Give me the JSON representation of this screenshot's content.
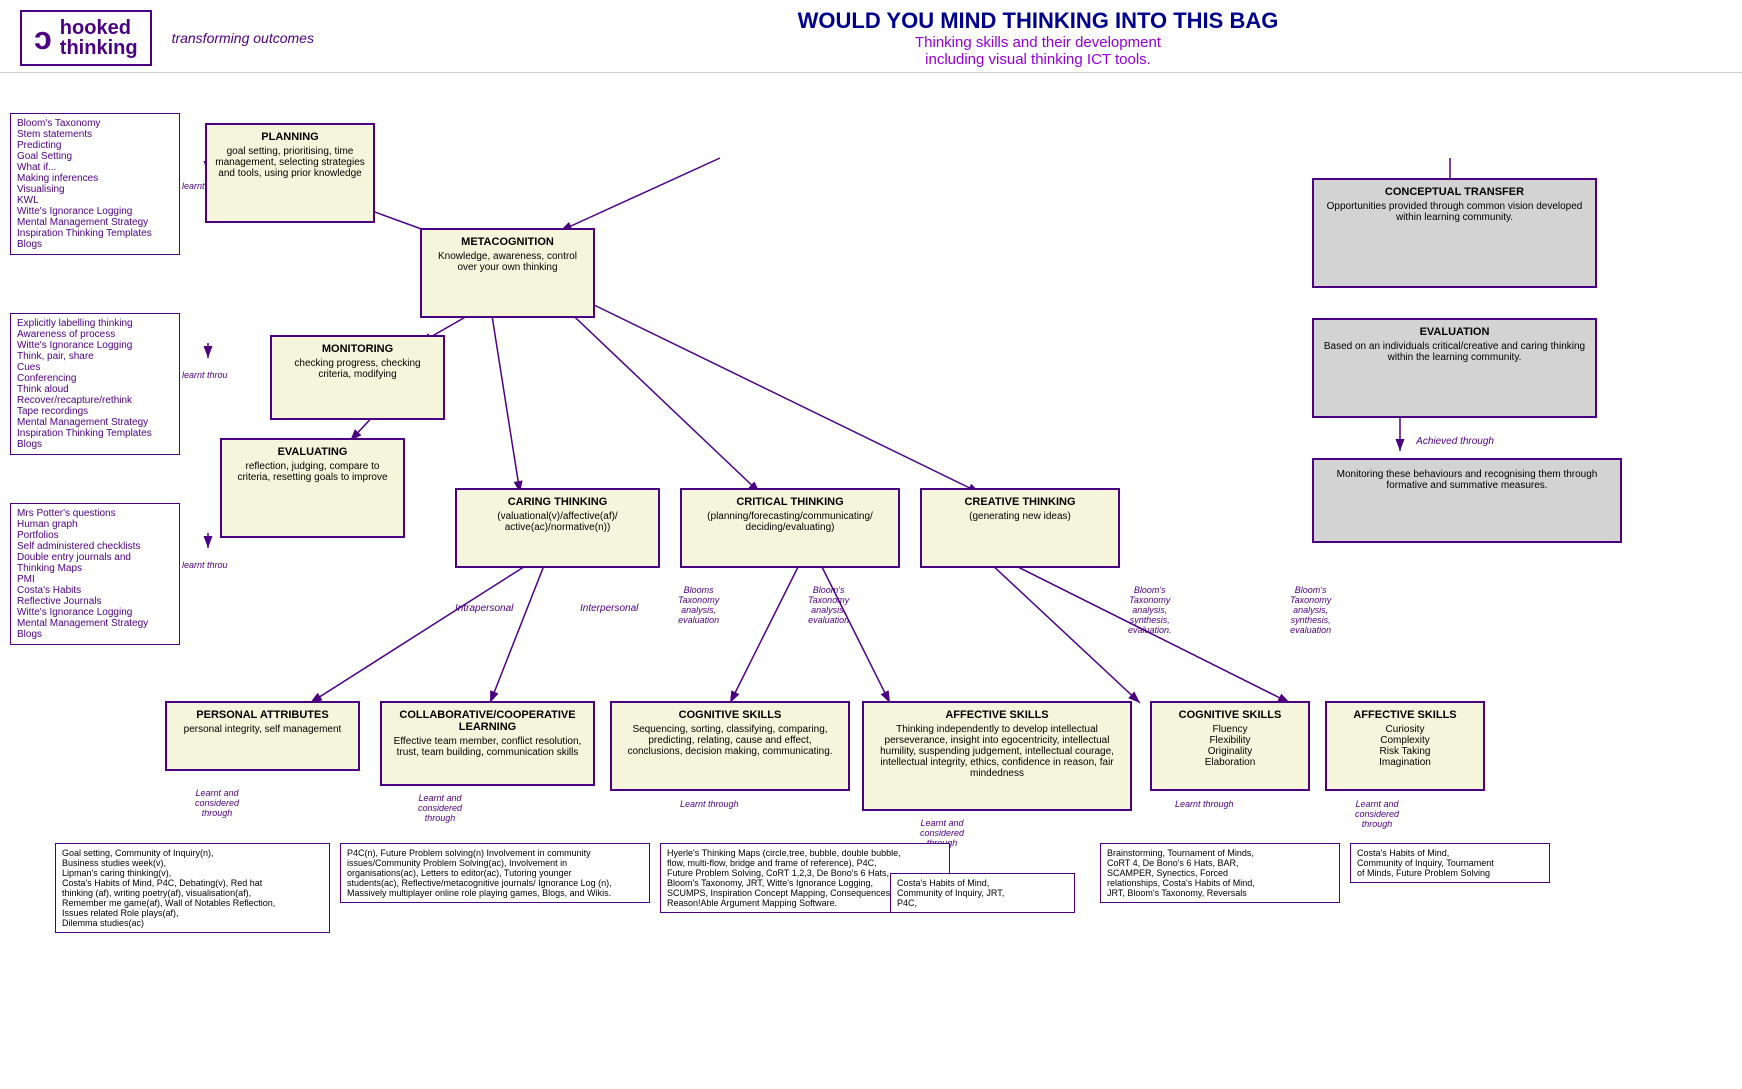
{
  "header": {
    "logo_line1": "hooked",
    "logo_line2": "thinking",
    "logo_hook": "ↄ",
    "tagline": "transforming outcomes",
    "main_title": "WOULD YOU MIND THINKING INTO THIS BAG",
    "sub_title": "Thinking skills and their development\nincluding visual thinking ICT tools."
  },
  "boxes": {
    "conceptual_transfer": {
      "title": "CONCEPTUAL  TRANSFER",
      "content": "Opportunities provided through common vision developed within learning community."
    },
    "evaluation": {
      "title": "EVALUATION",
      "content": "Based on an individuals critical/creative and caring thinking within the learning community."
    },
    "evaluation_sub": {
      "content": "Monitoring these behaviours and recognising them through formative and summative measures."
    },
    "planning": {
      "title": "PLANNING",
      "content": "goal setting, prioritising, time management, selecting strategies and tools, using prior knowledge"
    },
    "metacognition": {
      "title": "METACOGNITION",
      "content": "Knowledge, awareness, control over your own thinking"
    },
    "monitoring": {
      "title": "MONITORING",
      "content": "checking progress, checking criteria, modifying"
    },
    "evaluating": {
      "title": "EVALUATING",
      "content": "reflection, judging, compare to criteria, resetting goals to improve"
    },
    "caring_thinking": {
      "title": "CARING THINKING",
      "content": "(valuational(v)/affective(af)/\nactive(ac)/normative(n))"
    },
    "critical_thinking": {
      "title": "CRITICAL THINKING",
      "content": "(planning/forecasting/communicating/\ndeciding/evaluating)"
    },
    "creative_thinking": {
      "title": "CREATIVE THINKING",
      "content": "(generating new ideas)"
    },
    "personal_attributes": {
      "title": "PERSONAL ATTRIBUTES",
      "content": "personal integrity, self management"
    },
    "collaborative_learning": {
      "title": "COLLABORATIVE/COOPERATIVE\nLEARNING",
      "content": "Effective team member, conflict resolution, trust, team building, communication skills"
    },
    "cognitive_skills_center": {
      "title": "COGNITIVE SKILLS",
      "content": "Sequencing, sorting, classifying, comparing, predicting, relating, cause and effect, conclusions, decision making, communicating."
    },
    "affective_skills_center": {
      "title": "AFFECTIVE SKILLS",
      "content": "Thinking independently to develop intellectual perseverance, insight into egocentricity, intellectual humility, suspending judgement, intellectual courage, intellectual integrity, ethics, confidence in reason, fair mindedness"
    },
    "cognitive_skills_right": {
      "title": "COGNITIVE SKILLS",
      "content": "Fluency\nFlexibility\nOriginality\nElaboration"
    },
    "affective_skills_right": {
      "title": "AFFECTIVE SKILLS",
      "content": "Curiosity\nComplexity\nRisk Taking\nImagination"
    }
  },
  "labels": {
    "learnt_through1": "learnt throu",
    "learnt_through2": "learnt throu",
    "learnt_through3": "learnt throu",
    "intrapersonal": "Intrapersonal",
    "interpersonal": "Interpersonal",
    "blooms1": "Blooms\nTaxonomy\nanalysis,\nevaluation",
    "blooms2": "Bloom's\nTaxonomy\nanalysis,\nevaluation",
    "blooms3": "Bloom's\nTaxonomy\nanalysis,\nsynthesis,\nevaluation.",
    "blooms4": "Bloom's\nTaxonomy\nanalysis,\nsynthesis,\nevaluation",
    "learnt_considered1": "Learnt and\nconsidered\nthrough",
    "learnt_considered2": "Learnt and\nconsidered\nthrough",
    "learnt_through_bottom1": "Learnt through",
    "learnt_considered3": "Learnt and\nconsidered\nthrough",
    "learnt_through_bottom2": "Learnt through",
    "learnt_considered4": "Learnt and\nconsidered\nthrough",
    "achieved_through": "Achieved through"
  },
  "list_boxes": {
    "top_left": "Bloom's Taxonomy\nStem statements\nPredicting\nGoal Setting\nWhat if...\nMaking inferences\nVisualising\nKWL\nWitte's Ignorance Logging\nMental Management Strategy\nInspiration Thinking Templates\nBlogs",
    "middle_left": "Explicitly labelling thinking\nAwareness of process\nWitte's Ignorance Logging\nThink, pair, share\nCues\nConferencing\nThink aloud\nRecover/recapture/rethink\nTape recordings\nMental Management Strategy\nInspiration Thinking Templates\nBlogs",
    "bottom_left": "Mrs Potter's questions\nHuman graph\nPortfolios\nSelf administered checklists\nDouble entry journals and\nThinking Maps\nPMI\nCosta's Habits\nReflective Journals\nWitte's Ignorance Logging\nMental Management Strategy\nBlogs"
  },
  "bottom_boxes": {
    "personal_attrs_bottom": "Goal setting, Community of Inquiry(n),\nBusiness studies week(v),\nLipman's caring thinking(v),\nCosta's Habits of Mind, P4C, Debating(v), Red hat\nthinking (af), writing poetry(af), visualisation(af),\nRemember me game(af), Wall of Notables Reflection,\nIssues related Role plays(af),\nDilemma studies(ac)",
    "collaborative_bottom": "P4C(n), Future Problem solving(n) Involvement  in community\nissues/Community Problem Solving(ac), Involvement in\norganisations(ac), Letters to editor(ac), Tutoring younger\nstudents(ac), Reflective/metacognitive journals/ Ignorance Log (n),\nMassively multiplayer online role playing games, Blogs, and Wikis.",
    "cognitive_center_bottom": "Hyerle's Thinking Maps (circle,tree, bubble, double bubble,\nflow, multi-flow, bridge and frame of reference), P4C,\nFuture Problem Solving, CoRT 1,2,3, De Bono's 6 Hats,\nBloom's Taxonomy, JRT, Witte's Ignorance Logging,\nSCUMPS, Inspiration Concept Mapping, Consequences,\nReason!Able Argument Mapping Software.",
    "affective_center_bottom": "Costa's Habits of Mind,\nCommunity of Inquiry, JRT,\nP4C,",
    "cognitive_right_bottom": "Brainstorming, Tournament of Minds,\nCoRT 4, De Bono's 6 Hats, BAR,\nSCAMPER, Synectics, Forced\nrelationships, Costa's Habits of Mind,\nJRT, Bloom's Taxonomy, Reversals",
    "affective_right_bottom": "Costa's Habits of Mind,\nCommunity of Inquiry, Tournament\nof Minds, Future Problem Solving"
  }
}
